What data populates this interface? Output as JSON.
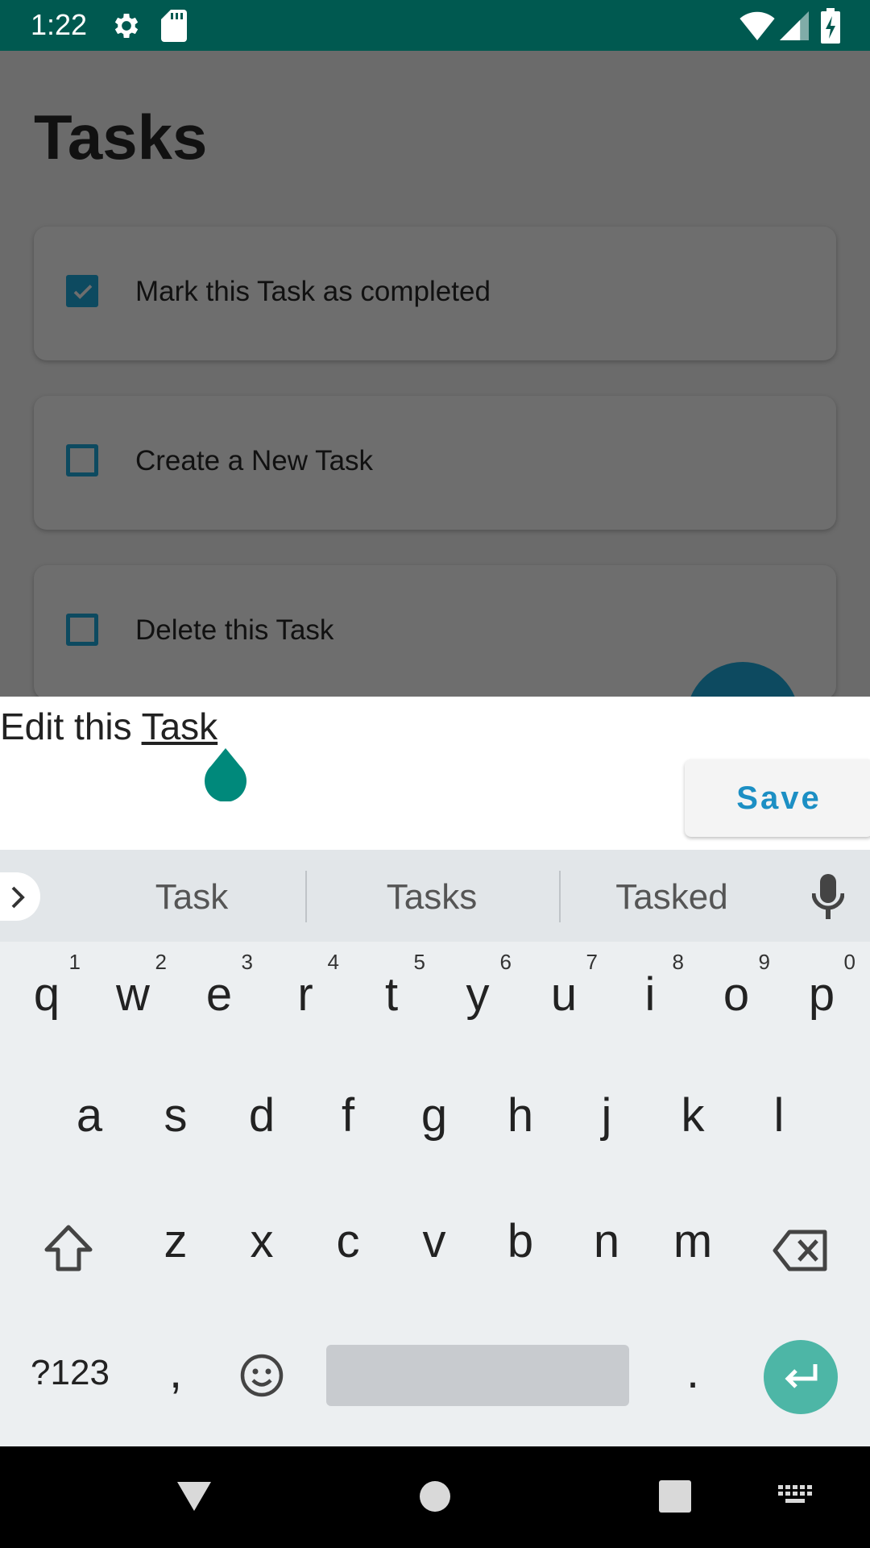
{
  "status_bar": {
    "time": "1:22",
    "icons": [
      "gear-icon",
      "sd-card-icon",
      "wifi-icon",
      "cell-signal-icon",
      "battery-charging-icon"
    ],
    "background": "#005950"
  },
  "app": {
    "title": "Tasks",
    "tasks": [
      {
        "label": "Mark this Task as completed",
        "checked": true
      },
      {
        "label": "Create a New Task",
        "checked": false
      },
      {
        "label": "Delete this Task",
        "checked": false
      }
    ],
    "accent": "#0d4a60"
  },
  "edit_panel": {
    "text_prefix": "Edit this ",
    "text_underlined": "Task",
    "save_label": "Save",
    "save_color": "#1c8fc4"
  },
  "keyboard": {
    "suggestions": [
      "Task",
      "Tasks",
      "Tasked"
    ],
    "row1": [
      {
        "ch": "q",
        "num": "1"
      },
      {
        "ch": "w",
        "num": "2"
      },
      {
        "ch": "e",
        "num": "3"
      },
      {
        "ch": "r",
        "num": "4"
      },
      {
        "ch": "t",
        "num": "5"
      },
      {
        "ch": "y",
        "num": "6"
      },
      {
        "ch": "u",
        "num": "7"
      },
      {
        "ch": "i",
        "num": "8"
      },
      {
        "ch": "o",
        "num": "9"
      },
      {
        "ch": "p",
        "num": "0"
      }
    ],
    "row2": [
      "a",
      "s",
      "d",
      "f",
      "g",
      "h",
      "j",
      "k",
      "l"
    ],
    "row3": [
      "z",
      "x",
      "c",
      "v",
      "b",
      "n",
      "m"
    ],
    "symbols_label": "?123",
    "comma": ",",
    "period": ".",
    "enter_color": "#4db6a6"
  },
  "nav_bar": {
    "icons": [
      "back-icon",
      "home-icon",
      "recents-icon",
      "keyboard-switch-icon"
    ]
  }
}
